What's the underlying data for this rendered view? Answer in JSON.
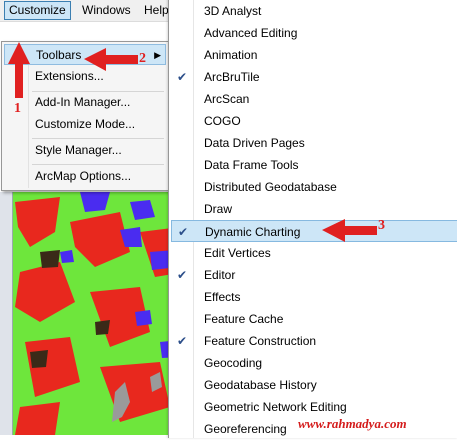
{
  "menubar": {
    "items": [
      {
        "label": "Customize",
        "active": true
      },
      {
        "label": "Windows",
        "active": false
      },
      {
        "label": "Help",
        "active": false
      }
    ]
  },
  "customize_menu": {
    "items": [
      {
        "label": "Toolbars",
        "has_submenu": true,
        "highlighted": true
      },
      {
        "label": "Extensions..."
      },
      {
        "label": "Add-In Manager..."
      },
      {
        "label": "Customize Mode..."
      },
      {
        "label": "Style Manager..."
      },
      {
        "label": "ArcMap Options..."
      }
    ]
  },
  "toolbars_submenu": {
    "items": [
      {
        "label": "3D Analyst",
        "checked": false
      },
      {
        "label": "Advanced Editing",
        "checked": false
      },
      {
        "label": "Animation",
        "checked": false
      },
      {
        "label": "ArcBruTile",
        "checked": true
      },
      {
        "label": "ArcScan",
        "checked": false
      },
      {
        "label": "COGO",
        "checked": false
      },
      {
        "label": "Data Driven Pages",
        "checked": false
      },
      {
        "label": "Data Frame Tools",
        "checked": false
      },
      {
        "label": "Distributed Geodatabase",
        "checked": false
      },
      {
        "label": "Draw",
        "checked": false
      },
      {
        "label": "Dynamic Charting",
        "checked": true,
        "highlighted": true
      },
      {
        "label": "Edit Vertices",
        "checked": false
      },
      {
        "label": "Editor",
        "checked": true
      },
      {
        "label": "Effects",
        "checked": false
      },
      {
        "label": "Feature Cache",
        "checked": false
      },
      {
        "label": "Feature Construction",
        "checked": true
      },
      {
        "label": "Geocoding",
        "checked": false
      },
      {
        "label": "Geodatabase History",
        "checked": false
      },
      {
        "label": "Geometric Network Editing",
        "checked": false
      },
      {
        "label": "Georeferencing",
        "checked": false
      }
    ]
  },
  "annotations": {
    "step1": "1",
    "step2": "2",
    "step3": "3",
    "color": "#e02020"
  },
  "watermark": "www.rahmadya.com",
  "colors": {
    "highlight": "#cde6f7",
    "map_green": "#6ee63c",
    "map_red": "#e8281e",
    "map_blue": "#4a2cf0"
  }
}
